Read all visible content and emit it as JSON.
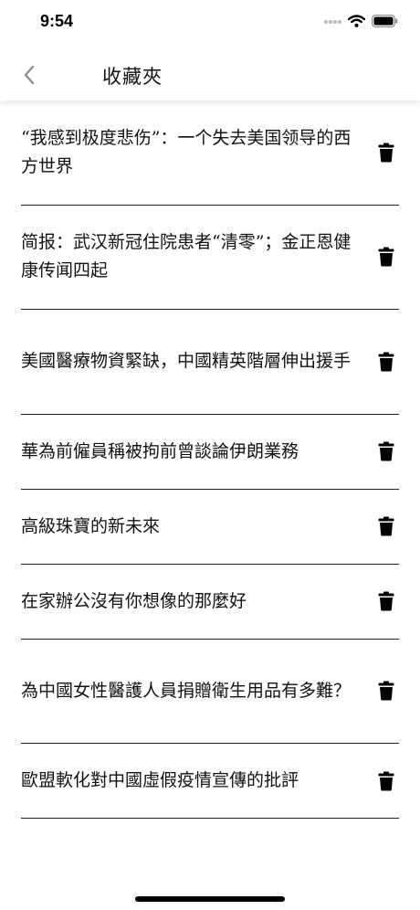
{
  "status_bar": {
    "time": "9:54",
    "icons": [
      "cellular-signal-icon",
      "wifi-icon",
      "battery-icon"
    ]
  },
  "nav": {
    "back_icon": "chevron-left-icon",
    "title": "收藏夾"
  },
  "favorites": [
    {
      "title": "“我感到极度悲伤”：一个失去美国领导的西方世界",
      "delete_icon": "trash-icon"
    },
    {
      "title": "简报：武汉新冠住院患者“清零”；金正恩健康传闻四起",
      "delete_icon": "trash-icon"
    },
    {
      "title": "美國醫療物資緊缺，中國精英階層伸出援手",
      "delete_icon": "trash-icon"
    },
    {
      "title": "華為前僱員稱被拘前曾談論伊朗業務",
      "delete_icon": "trash-icon"
    },
    {
      "title": "高級珠寶的新未來",
      "delete_icon": "trash-icon"
    },
    {
      "title": "在家辦公沒有你想像的那麼好",
      "delete_icon": "trash-icon"
    },
    {
      "title": "為中國女性醫護人員捐贈衛生用品有多難？",
      "delete_icon": "trash-icon"
    },
    {
      "title": "歐盟軟化對中國虛假疫情宣傳的批評",
      "delete_icon": "trash-icon"
    }
  ],
  "colors": {
    "text": "#111111",
    "divider": "#222222",
    "background": "#ffffff"
  }
}
